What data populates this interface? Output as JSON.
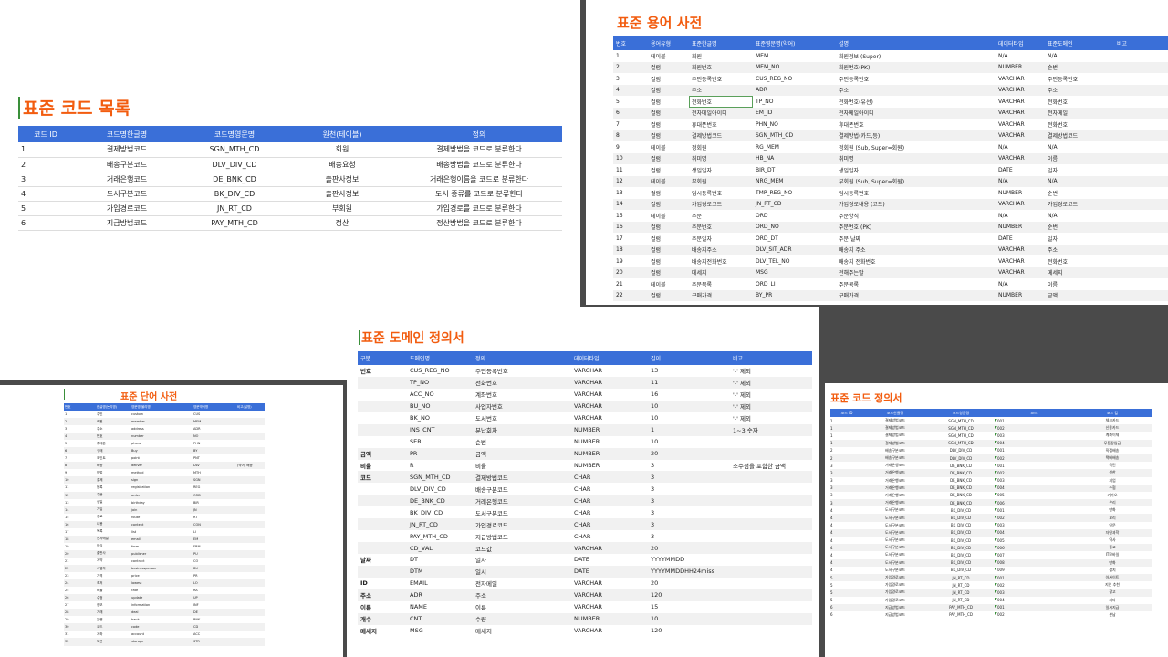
{
  "panel1": {
    "title": "표준 코드 목록",
    "headers": [
      "코드 ID",
      "코드명한글명",
      "코드명영문명",
      "원천(테이블)",
      "정의"
    ],
    "rows": [
      [
        "1",
        "결제방법코드",
        "SGN_MTH_CD",
        "회원",
        "결제방법을 코드로 분류한다"
      ],
      [
        "2",
        "배송구분코드",
        "DLV_DIV_CD",
        "배송요청",
        "배송방법을 코드로 분류한다"
      ],
      [
        "3",
        "거래은행코드",
        "DE_BNK_CD",
        "출판사정보",
        "거래은행이름을 코드로 분류한다"
      ],
      [
        "4",
        "도서구분코드",
        "BK_DIV_CD",
        "출판사정보",
        "도서 종류를 코드로 분류한다"
      ],
      [
        "5",
        "가입경로코드",
        "JN_RT_CD",
        "부회원",
        "가입경로를 코드로 분류한다"
      ],
      [
        "6",
        "지급방법코드",
        "PAY_MTH_CD",
        "정산",
        "정산방법을 코드로 분류한다"
      ]
    ]
  },
  "panel2": {
    "title": "표준 용어 사전",
    "headers": [
      "번호",
      "용어유형",
      "표준한글명",
      "표준영문명(약어)",
      "설명",
      "데이터타입",
      "표준도메인",
      "비고"
    ],
    "rows": [
      [
        "1",
        "테이블",
        "회원",
        "MEM",
        "회원정보 (Super)",
        "N/A",
        "N/A",
        ""
      ],
      [
        "2",
        "컬럼",
        "회원번호",
        "MEM_NO",
        "회원번호(PK)",
        "NUMBER",
        "순번",
        ""
      ],
      [
        "3",
        "컬럼",
        "주민등록번호",
        "CUS_REG_NO",
        "주민등록번호",
        "VARCHAR",
        "주민등록번호",
        ""
      ],
      [
        "4",
        "컬럼",
        "주소",
        "ADR",
        "주소",
        "VARCHAR",
        "주소",
        ""
      ],
      [
        "5",
        "컬럼",
        "전화번호",
        "TP_NO",
        "전화번호(유선)",
        "VARCHAR",
        "전화번호",
        ""
      ],
      [
        "6",
        "컬럼",
        "전자메일아이디",
        "EM_ID",
        "전자메일아이디",
        "VARCHAR",
        "전자메일",
        ""
      ],
      [
        "7",
        "컬럼",
        "휴대폰번호",
        "PHN_NO",
        "휴대폰번호",
        "VARCHAR",
        "전화번호",
        ""
      ],
      [
        "8",
        "컬럼",
        "결제방법코드",
        "SGN_MTH_CD",
        "결제방법(카드,등)",
        "VARCHAR",
        "결제방법코드",
        ""
      ],
      [
        "9",
        "테이블",
        "정회원",
        "RG_MEM",
        "정회원 (Sub, Super=회원)",
        "N/A",
        "N/A",
        ""
      ],
      [
        "10",
        "컬럼",
        "취미명",
        "HB_NA",
        "취미명",
        "VARCHAR",
        "이름",
        ""
      ],
      [
        "11",
        "컬럼",
        "생일일자",
        "BIR_DT",
        "생일일자",
        "DATE",
        "일자",
        ""
      ],
      [
        "12",
        "테이블",
        "부회원",
        "NRG_MEM",
        "부회원 (Sub, Super=회원)",
        "N/A",
        "N/A",
        ""
      ],
      [
        "13",
        "컬럼",
        "임시등록번호",
        "TMP_REG_NO",
        "임시등록번호",
        "NUMBER",
        "순번",
        ""
      ],
      [
        "14",
        "컬럼",
        "가입경로코드",
        "JN_RT_CD",
        "가입경로내용 (코드)",
        "VARCHAR",
        "가입경로코드",
        ""
      ],
      [
        "15",
        "테이블",
        "주문",
        "ORD",
        "주문양식",
        "N/A",
        "N/A",
        ""
      ],
      [
        "16",
        "컬럼",
        "주문번호",
        "ORD_NO",
        "주문번호 (PK)",
        "NUMBER",
        "순번",
        ""
      ],
      [
        "17",
        "컬럼",
        "주문일자",
        "ORD_DT",
        "주문 날짜",
        "DATE",
        "일자",
        ""
      ],
      [
        "18",
        "컬럼",
        "배송지주소",
        "DLV_SIT_ADR",
        "배송지 주소",
        "VARCHAR",
        "주소",
        ""
      ],
      [
        "19",
        "컬럼",
        "배송지전화번호",
        "DLV_TEL_NO",
        "배송지 전화번호",
        "VARCHAR",
        "전화번호",
        ""
      ],
      [
        "20",
        "컬럼",
        "메세지",
        "MSG",
        "전해주는말",
        "VARCHAR",
        "메세지",
        ""
      ],
      [
        "21",
        "테이블",
        "주문목록",
        "ORD_LI",
        "주문목록",
        "N/A",
        "이름",
        ""
      ],
      [
        "22",
        "컬럼",
        "구매가격",
        "BY_PR",
        "구매가격",
        "NUMBER",
        "금액",
        ""
      ]
    ]
  },
  "panel3": {
    "title": "표준 단어 사전",
    "headers": [
      "번호",
      "한글명(논리명)",
      "영문명(물리명)",
      "영문약어명",
      "비고(설명)"
    ],
    "rows": [
      [
        "1",
        "주민",
        "custom",
        "CUS",
        ""
      ],
      [
        "2",
        "회원",
        "member",
        "MEM",
        ""
      ],
      [
        "3",
        "주소",
        "address",
        "ADR",
        ""
      ],
      [
        "4",
        "번호",
        "number",
        "NO",
        ""
      ],
      [
        "5",
        "휴대폰",
        "phone",
        "PHN",
        ""
      ],
      [
        "6",
        "구매",
        "Buy",
        "BY",
        ""
      ],
      [
        "7",
        "포인트",
        "point",
        "PNT",
        ""
      ],
      [
        "8",
        "배송",
        "deliver",
        "DLV",
        "(약어) 배송"
      ],
      [
        "9",
        "방법",
        "method",
        "MTH",
        ""
      ],
      [
        "10",
        "결제",
        "sign",
        "SGN",
        ""
      ],
      [
        "11",
        "등록",
        "registration",
        "REG",
        ""
      ],
      [
        "12",
        "주문",
        "order",
        "ORD",
        ""
      ],
      [
        "13",
        "생일",
        "birthday",
        "BIR",
        ""
      ],
      [
        "14",
        "가입",
        "join",
        "JN",
        ""
      ],
      [
        "15",
        "경로",
        "route",
        "RT",
        ""
      ],
      [
        "16",
        "내용",
        "content",
        "CON",
        ""
      ],
      [
        "17",
        "목록",
        "list",
        "LI",
        ""
      ],
      [
        "18",
        "전자메일",
        "email",
        "EM",
        ""
      ],
      [
        "19",
        "양식",
        "form",
        "FRM",
        ""
      ],
      [
        "20",
        "출판사",
        "publisher",
        "PU",
        ""
      ],
      [
        "21",
        "계약",
        "contract",
        "CO",
        ""
      ],
      [
        "22",
        "사업자",
        "businessperson",
        "BU",
        ""
      ],
      [
        "23",
        "가격",
        "price",
        "PR",
        ""
      ],
      [
        "24",
        "최저",
        "lowest",
        "LO",
        ""
      ],
      [
        "25",
        "비율",
        "rate",
        "RA",
        ""
      ],
      [
        "26",
        "수정",
        "update",
        "UP",
        ""
      ],
      [
        "27",
        "정보",
        "information",
        "INF",
        ""
      ],
      [
        "28",
        "거래",
        "deal",
        "DE",
        ""
      ],
      [
        "29",
        "은행",
        "bank",
        "BNK",
        ""
      ],
      [
        "30",
        "코드",
        "code",
        "CD",
        ""
      ],
      [
        "31",
        "계좌",
        "account",
        "ACC",
        ""
      ],
      [
        "32",
        "보관",
        "storage",
        "STR",
        ""
      ]
    ]
  },
  "panel4": {
    "title": "표준 도메인 정의서",
    "headers": [
      "구분",
      "도메인명",
      "정의",
      "데이터타입",
      "길이",
      "비고"
    ],
    "rows": [
      [
        "번호",
        "CUS_REG_NO",
        "주민등록번호",
        "VARCHAR",
        "13",
        "'-' 제외"
      ],
      [
        "",
        "TP_NO",
        "전화번호",
        "VARCHAR",
        "11",
        "'-' 제외"
      ],
      [
        "",
        "ACC_NO",
        "계좌번호",
        "VARCHAR",
        "16",
        "'-' 제외"
      ],
      [
        "",
        "BU_NO",
        "사업자번호",
        "VARCHAR",
        "10",
        "'-' 제외"
      ],
      [
        "",
        "BK_NO",
        "도서번호",
        "VARCHAR",
        "10",
        "'-' 제외"
      ],
      [
        "",
        "INS_CNT",
        "분납회차",
        "NUMBER",
        "1",
        "1~3 숫자"
      ],
      [
        "",
        "SER",
        "순번",
        "NUMBER",
        "10",
        ""
      ],
      [
        "금액",
        "PR",
        "금액",
        "NUMBER",
        "20",
        ""
      ],
      [
        "비율",
        "R",
        "비율",
        "NUMBER",
        "3",
        "소수점을 포함한 금액"
      ],
      [
        "코드",
        "SGN_MTH_CD",
        "결제방법코드",
        "CHAR",
        "3",
        ""
      ],
      [
        "",
        "DLV_DIV_CD",
        "배송구분코드",
        "CHAR",
        "3",
        ""
      ],
      [
        "",
        "DE_BNK_CD",
        "거래은행코드",
        "CHAR",
        "3",
        ""
      ],
      [
        "",
        "BK_DIV_CD",
        "도서구분코드",
        "CHAR",
        "3",
        ""
      ],
      [
        "",
        "JN_RT_CD",
        "가입경로코드",
        "CHAR",
        "3",
        ""
      ],
      [
        "",
        "PAY_MTH_CD",
        "지급방법코드",
        "CHAR",
        "3",
        ""
      ],
      [
        "",
        "CD_VAL",
        "코드값",
        "VARCHAR",
        "20",
        ""
      ],
      [
        "날짜",
        "DT",
        "일자",
        "DATE",
        "YYYYMMDD",
        ""
      ],
      [
        "",
        "DTM",
        "일시",
        "DATE",
        "YYYYMMDDHH24miss",
        ""
      ],
      [
        "ID",
        "EMAIL",
        "전자메일",
        "VARCHAR",
        "20",
        ""
      ],
      [
        "주소",
        "ADR",
        "주소",
        "VARCHAR",
        "120",
        ""
      ],
      [
        "이름",
        "NAME",
        "이름",
        "VARCHAR",
        "15",
        ""
      ],
      [
        "개수",
        "CNT",
        "수량",
        "NUMBER",
        "10",
        ""
      ],
      [
        "메세지",
        "MSG",
        "메세지",
        "VARCHAR",
        "120",
        ""
      ]
    ]
  },
  "panel5": {
    "title": "표준 코드 정의서",
    "headers": [
      "코드 ID",
      "코드한글명",
      "코드영문명",
      "코드",
      "코드 값"
    ],
    "rows": [
      [
        "1",
        "결제방법코드",
        "SGN_MTH_CD",
        "001",
        "체크카드"
      ],
      [
        "1",
        "결제방법코드",
        "SGN_MTH_CD",
        "002",
        "신용카드"
      ],
      [
        "1",
        "결제방법코드",
        "SGN_MTH_CD",
        "003",
        "계좌이체"
      ],
      [
        "1",
        "결제방법코드",
        "SGN_MTH_CD",
        "004",
        "무통장입금"
      ],
      [
        "2",
        "배송구분코드",
        "DLV_DIV_CD",
        "001",
        "직접배송"
      ],
      [
        "2",
        "배송구분코드",
        "DLV_DIV_CD",
        "002",
        "택배배송"
      ],
      [
        "3",
        "거래은행코드",
        "DE_BNK_CD",
        "001",
        "국민"
      ],
      [
        "3",
        "거래은행코드",
        "DE_BNK_CD",
        "002",
        "신한"
      ],
      [
        "3",
        "거래은행코드",
        "DE_BNK_CD",
        "003",
        "기업"
      ],
      [
        "3",
        "거래은행코드",
        "DE_BNK_CD",
        "004",
        "수협"
      ],
      [
        "3",
        "거래은행코드",
        "DE_BNK_CD",
        "005",
        "카카오"
      ],
      [
        "3",
        "거래은행코드",
        "DE_BNK_CD",
        "006",
        "우리"
      ],
      [
        "4",
        "도서구분코드",
        "BK_DIV_CD",
        "001",
        "만화"
      ],
      [
        "4",
        "도서구분코드",
        "BK_DIV_CD",
        "002",
        "요리"
      ],
      [
        "4",
        "도서구분코드",
        "BK_DIV_CD",
        "003",
        "인문"
      ],
      [
        "4",
        "도서구분코드",
        "BK_DIV_CD",
        "004",
        "자연과학"
      ],
      [
        "4",
        "도서구분코드",
        "BK_DIV_CD",
        "005",
        "역사"
      ],
      [
        "4",
        "도서구분코드",
        "BK_DIV_CD",
        "006",
        "종교"
      ],
      [
        "4",
        "도서구분코드",
        "BK_DIV_CD",
        "007",
        "IT모바일"
      ],
      [
        "4",
        "도서구분코드",
        "BK_DIV_CD",
        "008",
        "만화"
      ],
      [
        "4",
        "도서구분코드",
        "BK_DIV_CD",
        "009",
        "잡지"
      ],
      [
        "5",
        "가입경로코드",
        "JN_RT_CD",
        "001",
        "아사이트"
      ],
      [
        "5",
        "가입경로코드",
        "JN_RT_CD",
        "002",
        "지인 추천"
      ],
      [
        "5",
        "가입경로코드",
        "JN_RT_CD",
        "003",
        "광고"
      ],
      [
        "5",
        "가입경로코드",
        "JN_RT_CD",
        "004",
        "기타"
      ],
      [
        "6",
        "지급방법코드",
        "PAY_MTH_CD",
        "001",
        "일시지급"
      ],
      [
        "6",
        "지급방법코드",
        "PAY_MTH_CD",
        "002",
        "분납"
      ]
    ]
  }
}
